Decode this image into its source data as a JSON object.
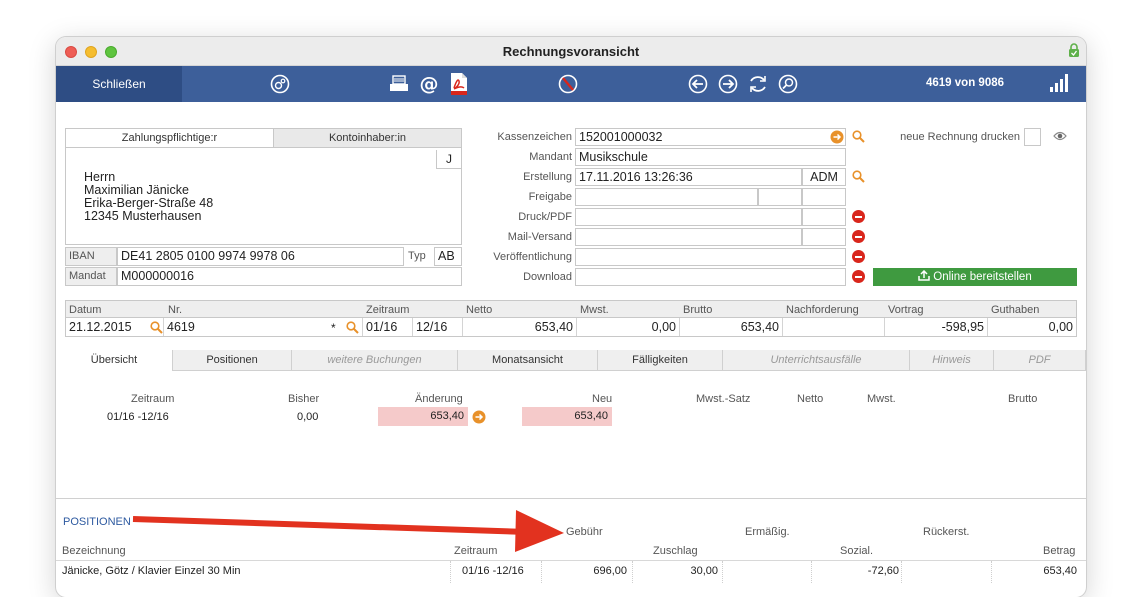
{
  "window": {
    "title": "Rechnungsvoransicht"
  },
  "toolbar": {
    "close_label": "Schließen",
    "record_count": "4619 von 9086"
  },
  "party": {
    "tab_payer": "Zahlungspflichtige:r",
    "tab_holder": "Kontoinhaber:in",
    "flag": "J",
    "address": [
      "Herrn",
      "Maximilian Jänicke",
      "Erika-Berger-Straße 48",
      "12345 Musterhausen"
    ],
    "iban_label": "IBAN",
    "iban": "DE41 2805 0100 9974 9978 06",
    "typ_label": "Typ",
    "typ": "AB",
    "mandat_label": "Mandat",
    "mandat": "M000000016"
  },
  "details": {
    "kassenzeichen_label": "Kassenzeichen",
    "kassenzeichen": "152001000032",
    "mandant_label": "Mandant",
    "mandant": "Musikschule",
    "erstellung_label": "Erstellung",
    "erstellung": "17.11.2016 13:26:36",
    "erstellung_user": "ADM",
    "freigabe_label": "Freigabe",
    "druck_label": "Druck/PDF",
    "mail_label": "Mail-Versand",
    "veroeff_label": "Veröffentlichung",
    "download_label": "Download",
    "print_new_label": "neue Rechnung drucken",
    "online_button": "Online bereitstellen"
  },
  "invoice": {
    "headers": [
      "Datum",
      "Nr.",
      "Zeitraum",
      "Netto",
      "Mwst.",
      "Brutto",
      "Nachforderung",
      "Vortrag",
      "Guthaben"
    ],
    "datum": "21.12.2015",
    "nr": "4619",
    "nr_flag": "*",
    "zeitraum_from": "01/16",
    "zeitraum_to": "12/16",
    "netto": "653,40",
    "mwst": "0,00",
    "brutto": "653,40",
    "nachforderung": "",
    "vortrag": "-598,95",
    "guthaben": "0,00"
  },
  "tabs": [
    "Übersicht",
    "Positionen",
    "weitere Buchungen",
    "Monatsansicht",
    "Fälligkeiten",
    "Unterrichtsausfälle",
    "Hinweis",
    "PDF"
  ],
  "overview": {
    "headers": [
      "Zeitraum",
      "Bisher",
      "Änderung",
      "Neu",
      "Mwst.-Satz",
      "Netto",
      "Mwst.",
      "Brutto"
    ],
    "row": {
      "zeitraum": "01/16 -12/16",
      "bisher": "0,00",
      "aenderung": "653,40",
      "neu": "653,40"
    }
  },
  "positions": {
    "section_title": "POSITIONEN",
    "group_headers": [
      "Gebühr",
      "Ermäßig.",
      "Rückerst."
    ],
    "headers": [
      "Bezeichnung",
      "Zeitraum",
      "Zuschlag",
      "Sozial.",
      "Betrag"
    ],
    "rows": [
      {
        "bezeichnung": "Jänicke, Götz / Klavier Einzel 30 Min",
        "zeitraum": "01/16 -12/16",
        "gebuehr": "696,00",
        "zuschlag": "30,00",
        "sozial": "-72,60",
        "betrag": "653,40"
      }
    ]
  },
  "colors": {
    "toolbar": "#3d5f9a",
    "toolbar_dark": "#2e4d84",
    "accent_orange": "#e8912a",
    "online_green": "#3f9a40",
    "highlight_pink": "#f5caca",
    "arrow_red": "#e2321f"
  }
}
